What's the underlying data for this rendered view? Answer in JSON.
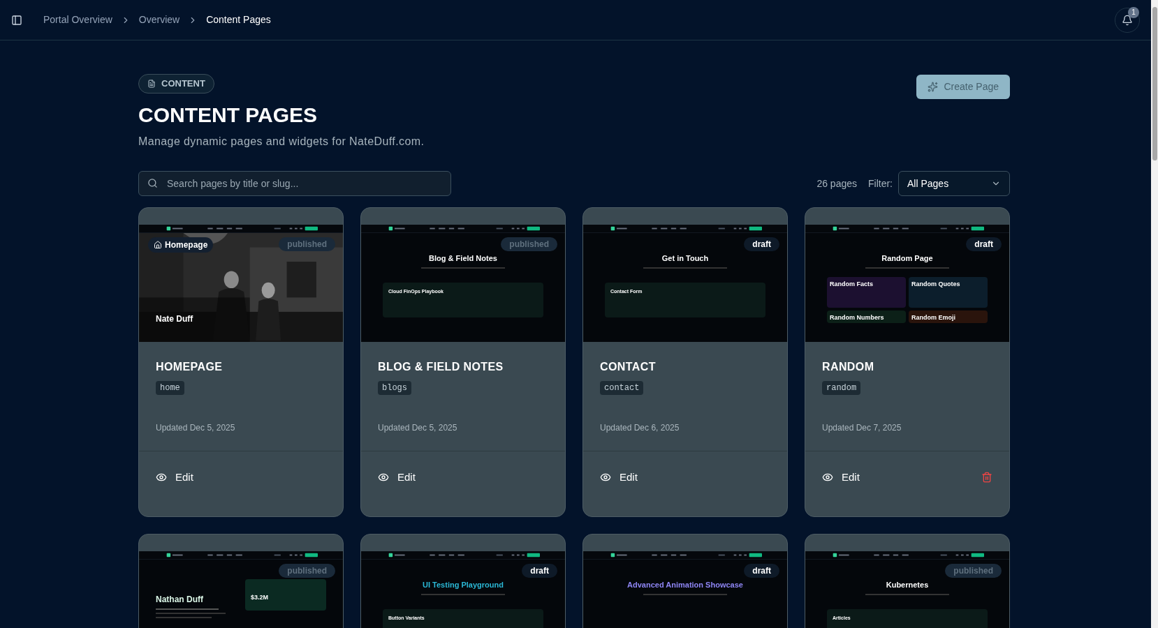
{
  "breadcrumbs": [
    {
      "label": "Portal Overview",
      "current": false
    },
    {
      "label": "Overview",
      "current": false
    },
    {
      "label": "Content Pages",
      "current": true
    }
  ],
  "notifications": {
    "count": "1"
  },
  "header": {
    "badge": "CONTENT",
    "title": "CONTENT PAGES",
    "subtitle": "Manage dynamic pages and widgets for NateDuff.com.",
    "create_button": "Create Page"
  },
  "search": {
    "placeholder": "Search pages by title or slug..."
  },
  "count": "26 pages",
  "filter": {
    "label": "Filter:",
    "value": "All Pages"
  },
  "pages": [
    {
      "title": "HOMEPAGE",
      "slug": "home",
      "updated": "Updated Dec 5, 2025",
      "status": "published",
      "home_label": "Homepage",
      "edit": "Edit",
      "deletable": false,
      "thumb": {
        "heading": "Nate Duff",
        "color": "#ffffff"
      }
    },
    {
      "title": "BLOG & FIELD NOTES",
      "slug": "blogs",
      "updated": "Updated Dec 5, 2025",
      "status": "published",
      "edit": "Edit",
      "deletable": false,
      "thumb": {
        "kind": "centered",
        "heading": "Blog & Field Notes",
        "color": "#ffffff",
        "items": [
          "Cloud FinOps Playbook"
        ]
      }
    },
    {
      "title": "CONTACT",
      "slug": "contact",
      "updated": "Updated Dec 6, 2025",
      "status": "draft",
      "edit": "Edit",
      "deletable": false,
      "thumb": {
        "kind": "centered",
        "heading": "Get in Touch",
        "color": "#ffffff",
        "items": [
          "Contact Form"
        ]
      }
    },
    {
      "title": "RANDOM",
      "slug": "random",
      "updated": "Updated Dec 7, 2025",
      "status": "draft",
      "edit": "Edit",
      "deletable": true,
      "thumb": {
        "kind": "grid",
        "heading": "Random Page",
        "color": "#ffffff",
        "items": [
          "Random Facts",
          "Random Quotes",
          "Random Numbers",
          "Random Emoji"
        ]
      }
    },
    {
      "status": "published",
      "thumb": {
        "kind": "hero",
        "heading": "Nathan Duff",
        "color": "#d9f5e6",
        "items": [
          "$3.2M"
        ]
      }
    },
    {
      "status": "draft",
      "thumb": {
        "kind": "centered",
        "heading": "UI Testing Playground",
        "color": "#2bb8d6",
        "items": [
          "Button Variants"
        ]
      }
    },
    {
      "status": "draft",
      "thumb": {
        "kind": "centered",
        "heading": "Advanced Animation Showcase",
        "color": "#8f86f5"
      }
    },
    {
      "status": "published",
      "thumb": {
        "kind": "centered",
        "heading": "Kubernetes",
        "color": "#ffffff",
        "items": [
          "Articles"
        ]
      }
    }
  ]
}
